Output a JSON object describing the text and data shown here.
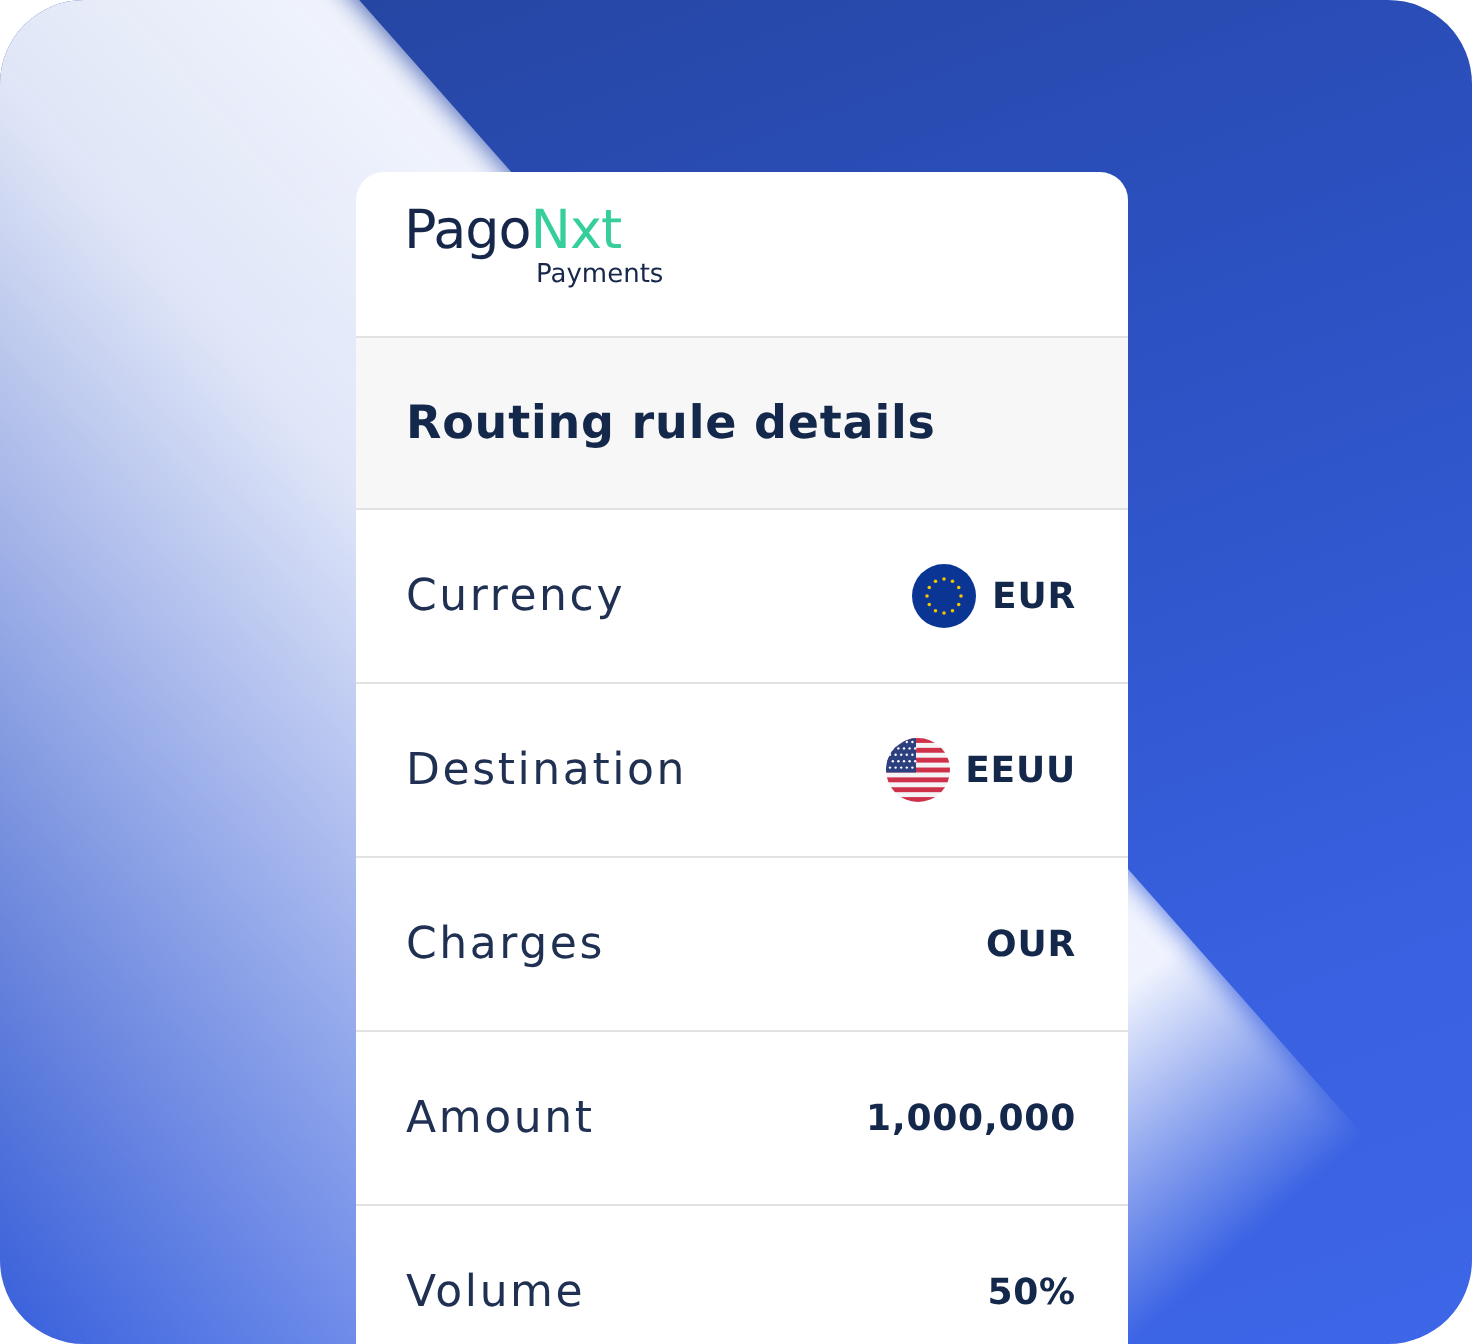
{
  "logo": {
    "name": "Pago",
    "name_accent": "Nxt",
    "tagline": "Payments"
  },
  "card": {
    "title": "Routing rule details"
  },
  "rows": [
    {
      "label": "Currency",
      "value": "EUR",
      "kind": "currency"
    },
    {
      "label": "Destination",
      "value": "EEUU",
      "kind": "country"
    },
    {
      "label": "Charges",
      "value": "OUR",
      "kind": "plain"
    },
    {
      "label": "Amount",
      "value": "1,000,000",
      "kind": "plain"
    },
    {
      "label": "Volume",
      "value": "50%",
      "kind": "plain"
    }
  ]
}
